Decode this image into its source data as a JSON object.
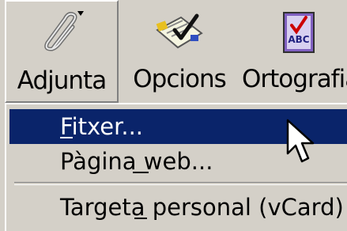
{
  "toolbar": {
    "attach": {
      "label": "Adjunta",
      "icon": "paperclip-icon"
    },
    "options": {
      "label": "Opcions",
      "icon": "checklist-icon"
    },
    "spelling": {
      "label": "Ortografia",
      "icon": "spellcheck-abc-icon"
    }
  },
  "menu": {
    "items": [
      {
        "label": "Fitxer...",
        "highlighted": true
      },
      {
        "label": "Pàgina web...",
        "highlighted": false
      },
      {
        "label": "Targeta personal (vCard)",
        "highlighted": false
      }
    ]
  },
  "colors": {
    "face": "#d4d0c8",
    "highlight": "#0a246a",
    "highlight_text": "#ffffff"
  }
}
